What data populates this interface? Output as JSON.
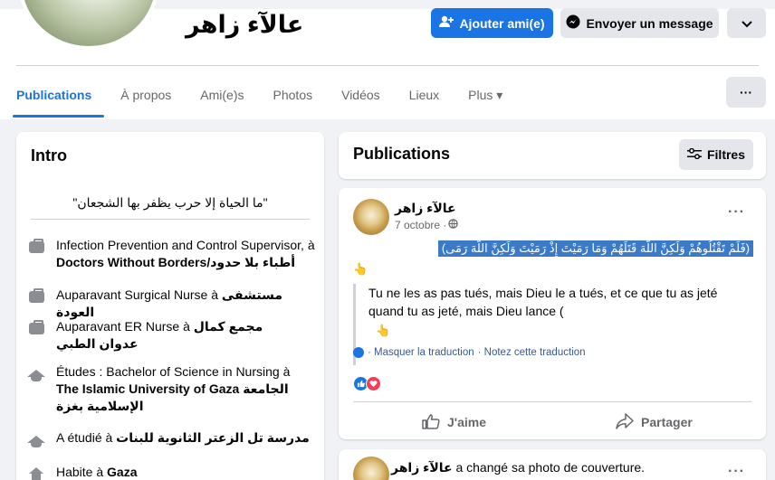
{
  "profile": {
    "name": "عالآء زاهر",
    "add_friend_label": "Ajouter ami(e)",
    "message_label": "Envoyer un message",
    "more_label": "⌄"
  },
  "tabs": [
    "Publications",
    "À propos",
    "Ami(e)s",
    "Photos",
    "Vidéos",
    "Lieux",
    "Plus ▾"
  ],
  "tabs_more_label": "···",
  "intro": {
    "title": "Intro",
    "bio": "\"ما الحياة إلا حرب يظفر بها الشجعان\"",
    "items": [
      {
        "icon": "briefcase-icon",
        "text": "Infection Prevention and Control Supervisor, à ",
        "bold": "Doctors Without Borders/أطباء بلا حدود"
      },
      {
        "icon": "briefcase-icon",
        "text": "Auparavant Surgical Nurse à ",
        "bold": "مستشفى العودة"
      },
      {
        "icon": "briefcase-icon",
        "text": "Auparavant ER Nurse à ",
        "bold": "مجمع كمال عدوان الطبي"
      },
      {
        "icon": "graduation-cap-icon",
        "text": "Études : Bachelor of Science in Nursing à ",
        "bold": "The Islamic University of Gaza الجامعة الإسلامية بغزة"
      },
      {
        "icon": "graduation-cap-icon",
        "text": "A étudié à ",
        "bold": "مدرسة تل الزعتر الثانوية للبنات"
      },
      {
        "icon": "home-icon",
        "text": "Habite à ",
        "bold": "Gaza"
      }
    ]
  },
  "publications": {
    "title": "Publications",
    "filters_label": "Filtres"
  },
  "post": {
    "author": "عالآء زاهر",
    "date": "7 octobre · ",
    "menu": "···",
    "verse": "(فَلَمْ تَقْتُلُوهُمْ وَلَكِنَّ اللَّهَ قَتَلَهُمْ وَمَا رَمَيْتَ إِذْ رَمَيْتَ وَلَكِنَّ اللَّهَ رَمَى)",
    "hand_emoji": "👆",
    "translation": "Tu ne les as pas tués, mais Dieu le a tués, et ce que tu as jeté quand tu as jeté, mais Dieu lance (",
    "hide_translation": "· Masquer la traduction",
    "rate_translation": "· Notez cette traduction",
    "like_label": "J'aime",
    "share_label": "Partager"
  },
  "post2": {
    "author": "عالآء زاهر",
    "text": " a changé sa photo de couverture.",
    "menu": "···"
  },
  "colors": {
    "accent": "#1b74e4",
    "love": "#f33e58",
    "highlight": "#3b79c9"
  }
}
